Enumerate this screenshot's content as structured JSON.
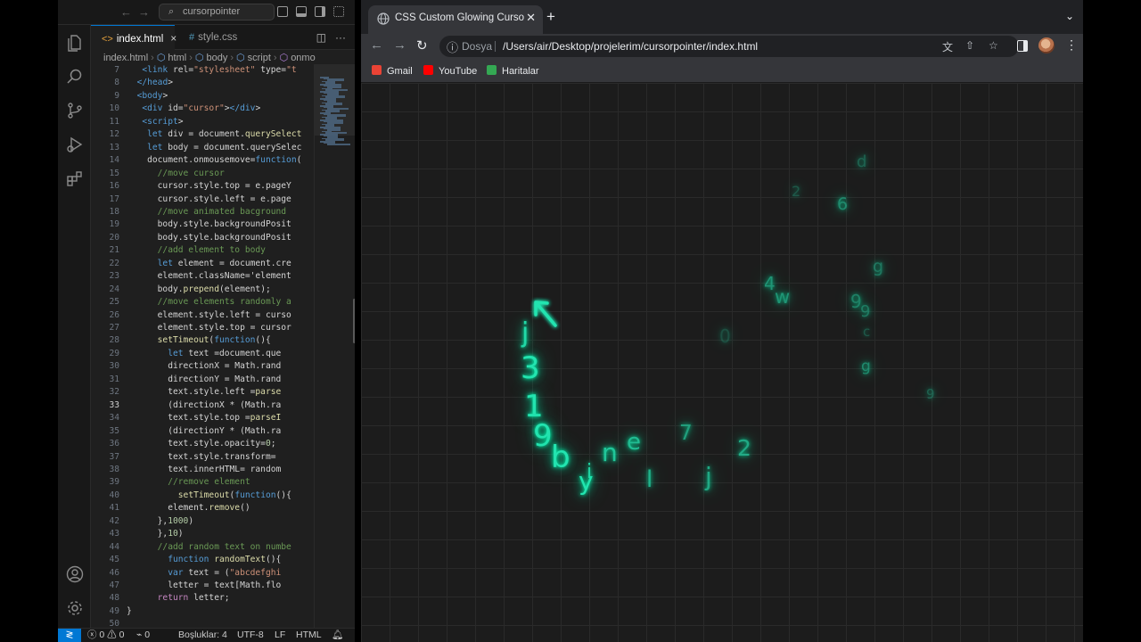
{
  "vscode": {
    "nav_back": "←",
    "nav_forward": "→",
    "search_text": "cursorpointer",
    "tabs": [
      {
        "label": "index.html",
        "icon": "html-file-icon",
        "active": true
      },
      {
        "label": "style.css",
        "icon": "css-file-icon",
        "active": false
      }
    ],
    "breadcrumb": [
      "index.html",
      "html",
      "body",
      "script",
      "onmo"
    ],
    "code_lines": [
      {
        "n": "7",
        "text": "<link rel=\"stylesheet\" type=\"t"
      },
      {
        "n": "8",
        "text": "</head>"
      },
      {
        "n": "9",
        "text": "<body>"
      },
      {
        "n": "10",
        "text": "<div id=\"cursor\"></div>"
      },
      {
        "n": "11",
        "text": "<script>"
      },
      {
        "n": "12",
        "text": "let div = document.querySelect"
      },
      {
        "n": "13",
        "text": "let body = document.querySelec"
      },
      {
        "n": "14",
        "text": "document.onmousemove=function("
      },
      {
        "n": "15",
        "text": "//move cursor"
      },
      {
        "n": "16",
        "text": "cursor.style.top = e.pageY"
      },
      {
        "n": "17",
        "text": "cursor.style.left = e.page"
      },
      {
        "n": "18",
        "text": "//move animated bacground"
      },
      {
        "n": "19",
        "text": "body.style.backgroundPosit"
      },
      {
        "n": "20",
        "text": "body.style.backgroundPosit"
      },
      {
        "n": "21",
        "text": "//add element to body"
      },
      {
        "n": "22",
        "text": "let element = document.cre"
      },
      {
        "n": "23",
        "text": "element.className='element"
      },
      {
        "n": "24",
        "text": "body.prepend(element);"
      },
      {
        "n": "25",
        "text": "//move elements randomly a"
      },
      {
        "n": "26",
        "text": "element.style.left = curso"
      },
      {
        "n": "27",
        "text": "element.style.top = cursor"
      },
      {
        "n": "28",
        "text": "setTimeout(function(){"
      },
      {
        "n": "29",
        "text": "let text =document.que"
      },
      {
        "n": "30",
        "text": "directionX = Math.rand"
      },
      {
        "n": "31",
        "text": "directionY = Math.rand"
      },
      {
        "n": "32",
        "text": "text.style.left =parse"
      },
      {
        "n": "33",
        "text": "(directionX * (Math.ra"
      },
      {
        "n": "34",
        "text": "text.style.top =parseI"
      },
      {
        "n": "35",
        "text": "(directionY * (Math.ra"
      },
      {
        "n": "36",
        "text": "text.style.opacity=0;"
      },
      {
        "n": "37",
        "text": "text.style.transform="
      },
      {
        "n": "38",
        "text": "text.innerHTML= random"
      },
      {
        "n": "39",
        "text": "//remove element"
      },
      {
        "n": "40",
        "text": "setTimeout(function(){"
      },
      {
        "n": "41",
        "text": "element.remove()"
      },
      {
        "n": "42",
        "text": "},1000)"
      },
      {
        "n": "43",
        "text": "},10)"
      },
      {
        "n": "44",
        "text": "//add random text on numbe"
      },
      {
        "n": "45",
        "text": "function randomText(){"
      },
      {
        "n": "46",
        "text": "var text = (\"abcdefghi"
      },
      {
        "n": "47",
        "text": "letter = text[Math.flo"
      },
      {
        "n": "48",
        "text": "return letter;"
      },
      {
        "n": "49",
        "text": "}"
      },
      {
        "n": "50",
        "text": ""
      }
    ],
    "status": {
      "errors": "0",
      "warnings": "0",
      "ports": "0",
      "indent": "Boşluklar: 4",
      "encoding": "UTF-8",
      "eol": "LF",
      "language": "HTML"
    }
  },
  "chrome": {
    "tab_title": "CSS Custom Glowing Curso",
    "new_tab": "+",
    "scheme_label": "Dosya",
    "url": "/Users/air/Desktop/projelerim/cursorpointer/index.html",
    "bookmarks": [
      {
        "label": "Gmail",
        "color": "#ea4335"
      },
      {
        "label": "YouTube",
        "color": "#ff0000"
      },
      {
        "label": "Haritalar",
        "color": "#34a853"
      }
    ],
    "glow_color": "#23e4b0",
    "page_glyphs": [
      {
        "char": "d",
        "opacity": 0.35
      },
      {
        "char": "2",
        "opacity": 0.3
      },
      {
        "char": "6",
        "opacity": 0.55
      },
      {
        "char": "g",
        "opacity": 0.45
      },
      {
        "char": "4",
        "opacity": 0.6
      },
      {
        "char": "w",
        "opacity": 0.6
      },
      {
        "char": "9",
        "opacity": 0.5
      },
      {
        "char": "9",
        "opacity": 0.45
      },
      {
        "char": "c",
        "opacity": 0.3
      },
      {
        "char": "g",
        "opacity": 0.55
      },
      {
        "char": "9",
        "opacity": 0.35
      },
      {
        "char": "0",
        "opacity": 0.25
      },
      {
        "char": "j",
        "opacity": 0.95
      },
      {
        "char": "3",
        "opacity": 1
      },
      {
        "char": "1",
        "opacity": 1
      },
      {
        "char": "9",
        "opacity": 1
      },
      {
        "char": "b",
        "opacity": 1
      },
      {
        "char": "y",
        "opacity": 1
      },
      {
        "char": "i",
        "opacity": 0.9
      },
      {
        "char": "n",
        "opacity": 0.85
      },
      {
        "char": "e",
        "opacity": 0.8
      },
      {
        "char": "7",
        "opacity": 0.65
      },
      {
        "char": "l",
        "opacity": 0.75
      },
      {
        "char": "j",
        "opacity": 0.7
      },
      {
        "char": "2",
        "opacity": 0.7
      }
    ]
  }
}
